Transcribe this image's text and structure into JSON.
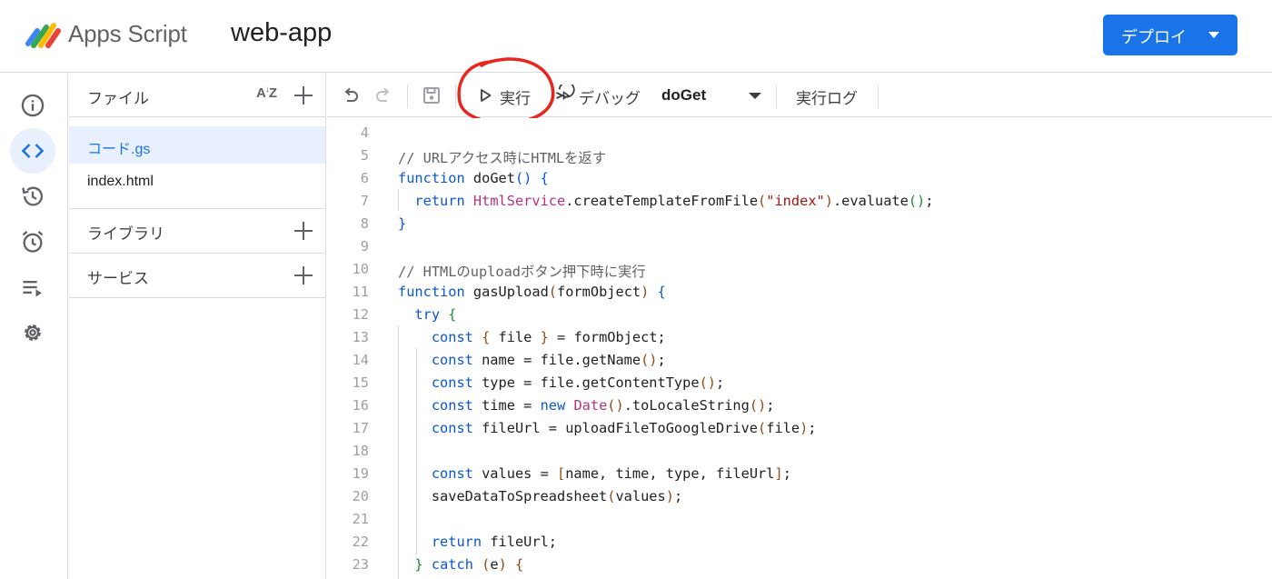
{
  "header": {
    "product_name": "Apps Script",
    "project_name": "web-app",
    "deploy_label": "デプロイ"
  },
  "rail": {
    "items": [
      "overview-icon",
      "editor-icon",
      "history-icon",
      "triggers-icon",
      "executions-icon",
      "settings-icon"
    ],
    "active": "editor-icon"
  },
  "files_panel": {
    "files_title": "ファイル",
    "files": [
      {
        "name": "コード.gs",
        "active": true
      },
      {
        "name": "index.html",
        "active": false
      }
    ],
    "libraries_title": "ライブラリ",
    "services_title": "サービス"
  },
  "toolbar": {
    "run_label": "実行",
    "debug_label": "デバッグ",
    "function_value": "doGet",
    "log_label": "実行ログ"
  },
  "colors": {
    "accent": "#1a73e8",
    "annotation": "#e8261c"
  },
  "code_lines": [
    {
      "n": "4",
      "tokens": []
    },
    {
      "n": "5",
      "tokens": [
        [
          "// URLアクセス時にHTMLを返す",
          "cm"
        ]
      ]
    },
    {
      "n": "6",
      "tokens": [
        [
          "function",
          "kw"
        ],
        [
          " doGet",
          ""
        ],
        [
          "()",
          "p1"
        ],
        [
          " ",
          ""
        ],
        [
          "{",
          "p1"
        ]
      ]
    },
    {
      "n": "7",
      "tokens": [
        [
          "  return",
          "kw"
        ],
        [
          " ",
          ""
        ],
        [
          "HtmlService",
          "cls"
        ],
        [
          ".createTemplateFromFile",
          ""
        ],
        [
          "(",
          "p2"
        ],
        [
          "\"index\"",
          "str"
        ],
        [
          ")",
          "p2"
        ],
        [
          ".evaluate",
          ""
        ],
        [
          "()",
          "p3"
        ],
        [
          ";",
          ""
        ]
      ]
    },
    {
      "n": "8",
      "tokens": [
        [
          "}",
          "p1"
        ]
      ]
    },
    {
      "n": "9",
      "tokens": []
    },
    {
      "n": "10",
      "tokens": [
        [
          "// HTMLのuploadボタン押下時に実行",
          "cm"
        ]
      ]
    },
    {
      "n": "11",
      "tokens": [
        [
          "function",
          "kw"
        ],
        [
          " gasUpload",
          ""
        ],
        [
          "(",
          "p2"
        ],
        [
          "formObject",
          ""
        ],
        [
          ")",
          "p2"
        ],
        [
          " ",
          ""
        ],
        [
          "{",
          "p1"
        ]
      ]
    },
    {
      "n": "12",
      "tokens": [
        [
          "  try",
          "kw"
        ],
        [
          " ",
          ""
        ],
        [
          "{",
          "p3"
        ]
      ]
    },
    {
      "n": "13",
      "tokens": [
        [
          "    const",
          "kw"
        ],
        [
          " ",
          ""
        ],
        [
          "{",
          "p2"
        ],
        [
          " file ",
          ""
        ],
        [
          "}",
          "p2"
        ],
        [
          " = formObject;",
          ""
        ]
      ]
    },
    {
      "n": "14",
      "tokens": [
        [
          "    const",
          "kw"
        ],
        [
          " name = file.getName",
          ""
        ],
        [
          "()",
          "p2"
        ],
        [
          ";",
          ""
        ]
      ]
    },
    {
      "n": "15",
      "tokens": [
        [
          "    const",
          "kw"
        ],
        [
          " type = file.getContentType",
          ""
        ],
        [
          "()",
          "p2"
        ],
        [
          ";",
          ""
        ]
      ]
    },
    {
      "n": "16",
      "tokens": [
        [
          "    const",
          "kw"
        ],
        [
          " time = ",
          ""
        ],
        [
          "new",
          "kw"
        ],
        [
          " ",
          ""
        ],
        [
          "Date",
          "cls"
        ],
        [
          "()",
          "p2"
        ],
        [
          ".toLocaleString",
          ""
        ],
        [
          "()",
          "p2"
        ],
        [
          ";",
          ""
        ]
      ]
    },
    {
      "n": "17",
      "tokens": [
        [
          "    const",
          "kw"
        ],
        [
          " fileUrl = uploadFileToGoogleDrive",
          ""
        ],
        [
          "(",
          "p2"
        ],
        [
          "file",
          ""
        ],
        [
          ")",
          "p2"
        ],
        [
          ";",
          ""
        ]
      ]
    },
    {
      "n": "18",
      "tokens": []
    },
    {
      "n": "19",
      "tokens": [
        [
          "    const",
          "kw"
        ],
        [
          " values = ",
          ""
        ],
        [
          "[",
          "p2"
        ],
        [
          "name, time, type, fileUrl",
          ""
        ],
        [
          "]",
          "p2"
        ],
        [
          ";",
          ""
        ]
      ]
    },
    {
      "n": "20",
      "tokens": [
        [
          "    saveDataToSpreadsheet",
          ""
        ],
        [
          "(",
          "p2"
        ],
        [
          "values",
          ""
        ],
        [
          ")",
          "p2"
        ],
        [
          ";",
          ""
        ]
      ]
    },
    {
      "n": "21",
      "tokens": []
    },
    {
      "n": "22",
      "tokens": [
        [
          "    return",
          "kw"
        ],
        [
          " fileUrl;",
          ""
        ]
      ]
    },
    {
      "n": "23",
      "tokens": [
        [
          "  ",
          ""
        ],
        [
          "}",
          "p3"
        ],
        [
          " ",
          ""
        ],
        [
          "catch",
          "kw"
        ],
        [
          " ",
          ""
        ],
        [
          "(",
          "p2"
        ],
        [
          "e",
          ""
        ],
        [
          ")",
          "p2"
        ],
        [
          " ",
          ""
        ],
        [
          "{",
          "p2"
        ]
      ]
    }
  ]
}
